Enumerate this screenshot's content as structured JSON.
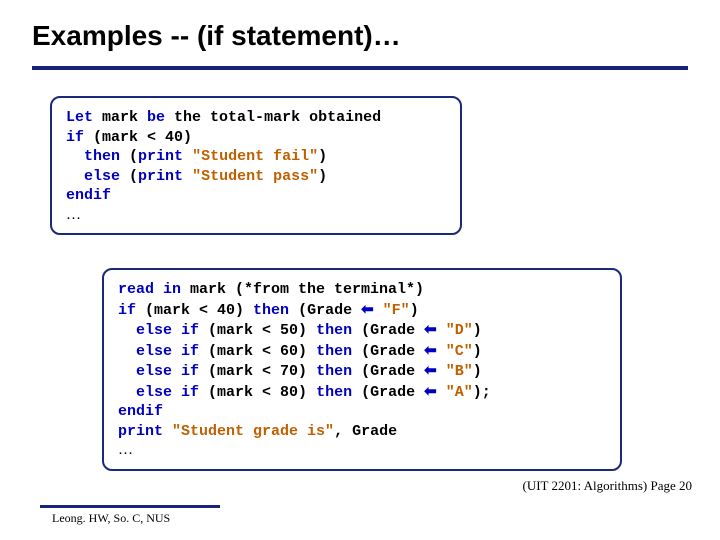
{
  "title": "Examples -- (if statement)…",
  "box1": {
    "l1a": "Let",
    "l1b": " mark ",
    "l1c": "be",
    "l1d": " the total-mark obtained",
    "l2a": "if",
    "l2b": " (mark < 40)",
    "l3a": "  ",
    "l3b": "then",
    "l3c": " (",
    "l3d": "print",
    "l3e": " ",
    "l3f": "\"Student fail\"",
    "l3g": ")",
    "l4a": "  ",
    "l4b": "else",
    "l4c": " (",
    "l4d": "print",
    "l4e": " ",
    "l4f": "\"Student pass\"",
    "l4g": ")",
    "l5a": "endif",
    "l6": "…"
  },
  "box2": {
    "l1a": "read in",
    "l1b": " mark (*from the terminal*)",
    "l2a": "if",
    "l2b": " (mark < 40) ",
    "l2c": "then",
    "l2d": " (Grade ",
    "l2e": "⬅",
    "l2f": " ",
    "l2g": "\"F\"",
    "l2h": ")",
    "l3a": "  ",
    "l3b": "else if",
    "l3c": " (mark < 50) ",
    "l3d": "then",
    "l3e": " (Grade ",
    "l3f": "⬅",
    "l3g": " ",
    "l3h": "\"D\"",
    "l3i": ")",
    "l4a": "  ",
    "l4b": "else if",
    "l4c": " (mark < 60) ",
    "l4d": "then",
    "l4e": " (Grade ",
    "l4f": "⬅",
    "l4g": " ",
    "l4h": "\"C\"",
    "l4i": ")",
    "l5a": "  ",
    "l5b": "else if",
    "l5c": " (mark < 70) ",
    "l5d": "then",
    "l5e": " (Grade ",
    "l5f": "⬅",
    "l5g": " ",
    "l5h": "\"B\"",
    "l5i": ")",
    "l6a": "  ",
    "l6b": "else if",
    "l6c": " (mark < 80) ",
    "l6d": "then",
    "l6e": " (Grade ",
    "l6f": "⬅",
    "l6g": " ",
    "l6h": "\"A\"",
    "l6i": ");",
    "l7a": "endif",
    "l8a": "print",
    "l8b": " ",
    "l8c": "\"Student grade is\"",
    "l8d": ", Grade",
    "l9": "…"
  },
  "footer_right": "(UIT 2201: Algorithms) Page 20",
  "footer_left": "Leong. HW, So. C, NUS"
}
